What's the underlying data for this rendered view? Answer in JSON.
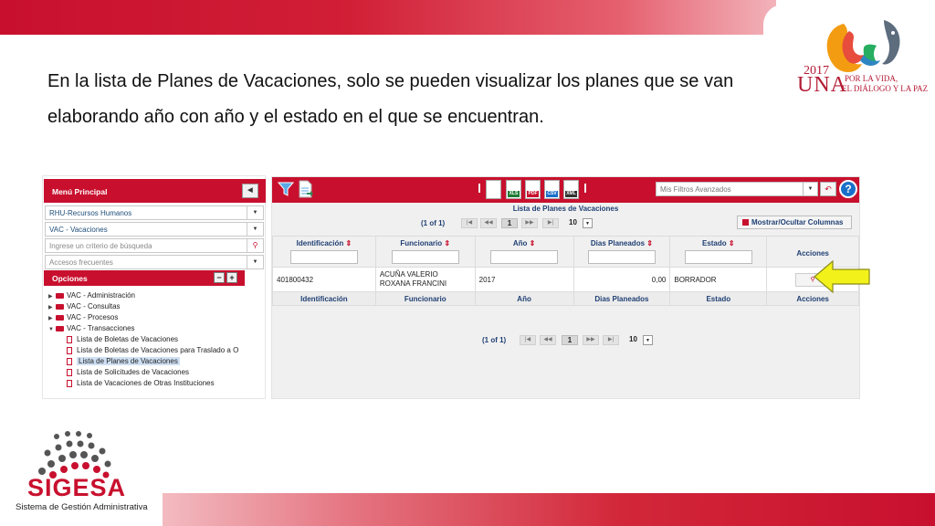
{
  "caption": "En la lista de Planes de Vacaciones, solo se pueden visualizar los planes que se van elaborando año con año y el estado en el que se encuentran.",
  "una_logo": {
    "year": "2017",
    "name": "UNA",
    "motto_line1": "POR LA VIDA,",
    "motto_line2": "EL DIÁLOGO Y LA PAZ"
  },
  "sigesa_logo": {
    "name": "SIGESA",
    "subtitle": "Sistema de Gestión Administrativa"
  },
  "colors": {
    "brand_red": "#c8102e",
    "header_text": "#1f3f73",
    "arrow": "#f2f21a"
  },
  "menu": {
    "title": "Menú Principal",
    "collapse_icon": "chevron-left-icon",
    "module_select": "RHU-Recursos Humanos",
    "submodule_select": "VAC - Vacaciones",
    "search_placeholder": "Ingrese un criterio de búsqueda",
    "frequent_placeholder": "Accesos frecuentes",
    "options_title": "Opciones",
    "collapse_all": "−",
    "expand_all": "+",
    "tree": [
      {
        "label": "VAC - Administración",
        "expanded": false
      },
      {
        "label": "VAC - Consultas",
        "expanded": false
      },
      {
        "label": "VAC - Procesos",
        "expanded": false
      },
      {
        "label": "VAC - Transacciones",
        "expanded": true
      }
    ],
    "leaves": [
      {
        "label": "Lista de Boletas de Vacaciones",
        "selected": false
      },
      {
        "label": "Lista de Boletas de Vacaciones para Traslado a O",
        "selected": false
      },
      {
        "label": "Lista de Planes de Vacaciones",
        "selected": true
      },
      {
        "label": "Lista de Solicitudes de Vacaciones",
        "selected": false
      },
      {
        "label": "Lista de Vacaciones de Otras Instituciones",
        "selected": false
      }
    ]
  },
  "toolbar": {
    "exports": [
      "XLS",
      "PDF",
      "CSV",
      "XML"
    ],
    "filters_placeholder": "Mis Filtros Avanzados",
    "help": "?"
  },
  "grid": {
    "title": "Lista de Planes de Vacaciones",
    "pager": {
      "count": "(1 of 1)",
      "current_page": "1",
      "rows_per_page": "10"
    },
    "toggle_columns": "Mostrar/Ocultar Columnas",
    "columns": [
      "Identificación",
      "Funcionario",
      "Año",
      "Dias Planeados",
      "Estado",
      "Acciones"
    ],
    "rows": [
      {
        "identificacion": "401800432",
        "funcionario_1": "ACUÑA VALERIO",
        "funcionario_2": "ROXANA FRANCINI",
        "anio": "2017",
        "dias": "0,00",
        "estado": "BORRADOR"
      }
    ]
  }
}
